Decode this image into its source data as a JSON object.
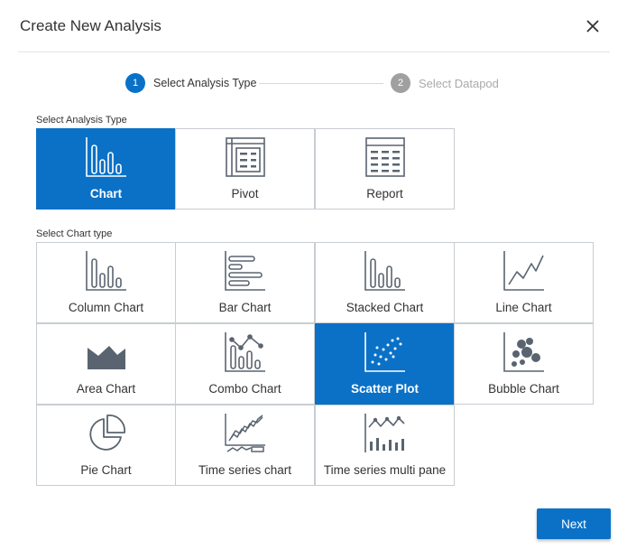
{
  "dialog": {
    "title": "Create New Analysis"
  },
  "stepper": {
    "steps": [
      {
        "number": "1",
        "label": "Select Analysis Type",
        "state": "active"
      },
      {
        "number": "2",
        "label": "Select Datapod",
        "state": "inactive"
      }
    ]
  },
  "analysis_type": {
    "label": "Select Analysis Type",
    "options": [
      {
        "label": "Chart",
        "icon": "column-chart-icon",
        "selected": true
      },
      {
        "label": "Pivot",
        "icon": "pivot-table-icon",
        "selected": false
      },
      {
        "label": "Report",
        "icon": "report-table-icon",
        "selected": false
      }
    ]
  },
  "chart_type": {
    "label": "Select Chart type",
    "options": [
      {
        "label": "Column Chart",
        "icon": "column-chart-icon",
        "selected": false
      },
      {
        "label": "Bar Chart",
        "icon": "bar-chart-icon",
        "selected": false
      },
      {
        "label": "Stacked Chart",
        "icon": "stacked-chart-icon",
        "selected": false
      },
      {
        "label": "Line Chart",
        "icon": "line-chart-icon",
        "selected": false
      },
      {
        "label": "Area Chart",
        "icon": "area-chart-icon",
        "selected": false
      },
      {
        "label": "Combo Chart",
        "icon": "combo-chart-icon",
        "selected": false
      },
      {
        "label": "Scatter Plot",
        "icon": "scatter-plot-icon",
        "selected": true
      },
      {
        "label": "Bubble Chart",
        "icon": "bubble-chart-icon",
        "selected": false
      },
      {
        "label": "Pie Chart",
        "icon": "pie-chart-icon",
        "selected": false
      },
      {
        "label": "Time series chart",
        "icon": "time-series-icon",
        "selected": false
      },
      {
        "label": "Time series multi pane",
        "icon": "time-series-multi-pane-icon",
        "selected": false
      }
    ]
  },
  "footer": {
    "next_label": "Next"
  },
  "colors": {
    "accent": "#0a71c7",
    "icon": "#5a6470",
    "border": "#c8cdd2"
  }
}
